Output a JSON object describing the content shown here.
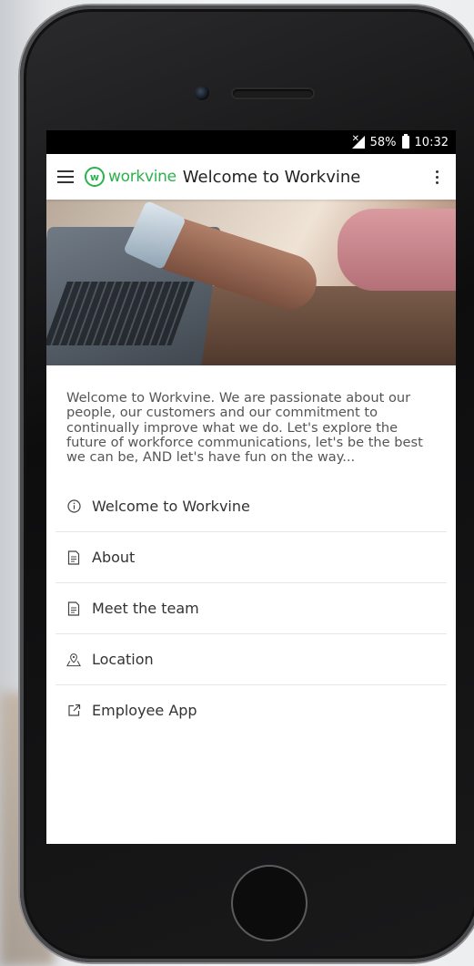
{
  "status_bar": {
    "battery": "58%",
    "time": "10:32"
  },
  "app_bar": {
    "logo_mark": "w",
    "logo_text": "workvine",
    "title": "Welcome to Workvine"
  },
  "intro_text": "Welcome to Workvine. We are passionate about our people, our customers and our commitment to continually improve what we do. Let's explore the future of workforce communications, let's be the best we can be, AND let's have fun on the way...",
  "nav": {
    "items": [
      {
        "icon": "info-icon",
        "label": "Welcome to Workvine"
      },
      {
        "icon": "document-icon",
        "label": "About"
      },
      {
        "icon": "document-icon",
        "label": "Meet the team"
      },
      {
        "icon": "map-pin-icon",
        "label": "Location"
      },
      {
        "icon": "external-link-icon",
        "label": "Employee App"
      }
    ]
  },
  "colors": {
    "brand": "#2bb24c",
    "status_bar_bg": "#000000"
  }
}
